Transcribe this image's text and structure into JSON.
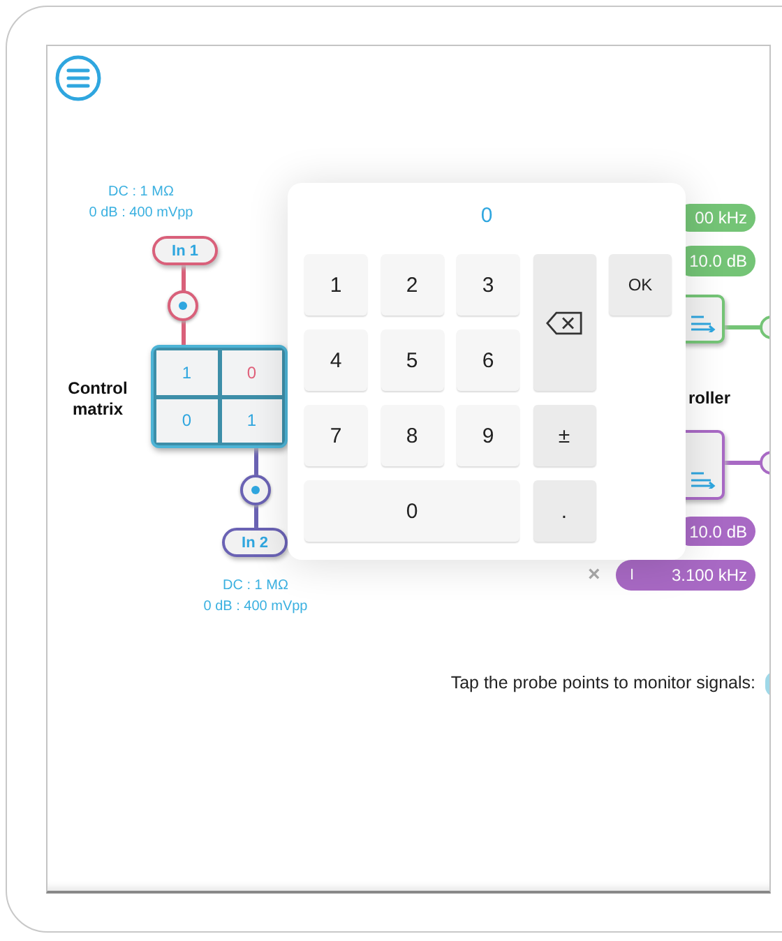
{
  "inputs": [
    {
      "label": "In 1",
      "info": [
        "DC : 1 MΩ",
        "0 dB : 400 mVpp"
      ],
      "color": "#d9607a"
    },
    {
      "label": "In 2",
      "info": [
        "DC : 1 MΩ",
        "0 dB : 400 mVpp"
      ],
      "color": "#6a62b4"
    }
  ],
  "control_matrix": {
    "label": "Control matrix",
    "cells": [
      {
        "value": "1",
        "selected": false
      },
      {
        "value": "0",
        "selected": true
      },
      {
        "value": "0",
        "selected": false
      },
      {
        "value": "1",
        "selected": false
      }
    ]
  },
  "keypad": {
    "display": "0",
    "keys": [
      {
        "kind": "digit",
        "label": "1"
      },
      {
        "kind": "digit",
        "label": "2"
      },
      {
        "kind": "digit",
        "label": "3"
      },
      {
        "kind": "backspace"
      },
      {
        "kind": "ok",
        "label": "OK"
      },
      {
        "kind": "digit",
        "label": "4"
      },
      {
        "kind": "digit",
        "label": "5"
      },
      {
        "kind": "digit",
        "label": "6"
      },
      {
        "kind": "digit",
        "label": "7"
      },
      {
        "kind": "digit",
        "label": "8"
      },
      {
        "kind": "digit",
        "label": "9"
      },
      {
        "kind": "function",
        "label": "±"
      },
      {
        "kind": "digit",
        "label": "0"
      },
      {
        "kind": "function",
        "label": "."
      }
    ]
  },
  "outputs": [
    {
      "color": "#74c476",
      "frequency": "00 kHz",
      "gain": "10.0 dB"
    },
    {
      "color": "#a869c4",
      "gain": "10.0 dB",
      "frequency": "3.100 kHz",
      "toggle": "I",
      "remove": "×"
    }
  ],
  "controller_label": "roller",
  "hint": "Tap the probe points to monitor signals:"
}
